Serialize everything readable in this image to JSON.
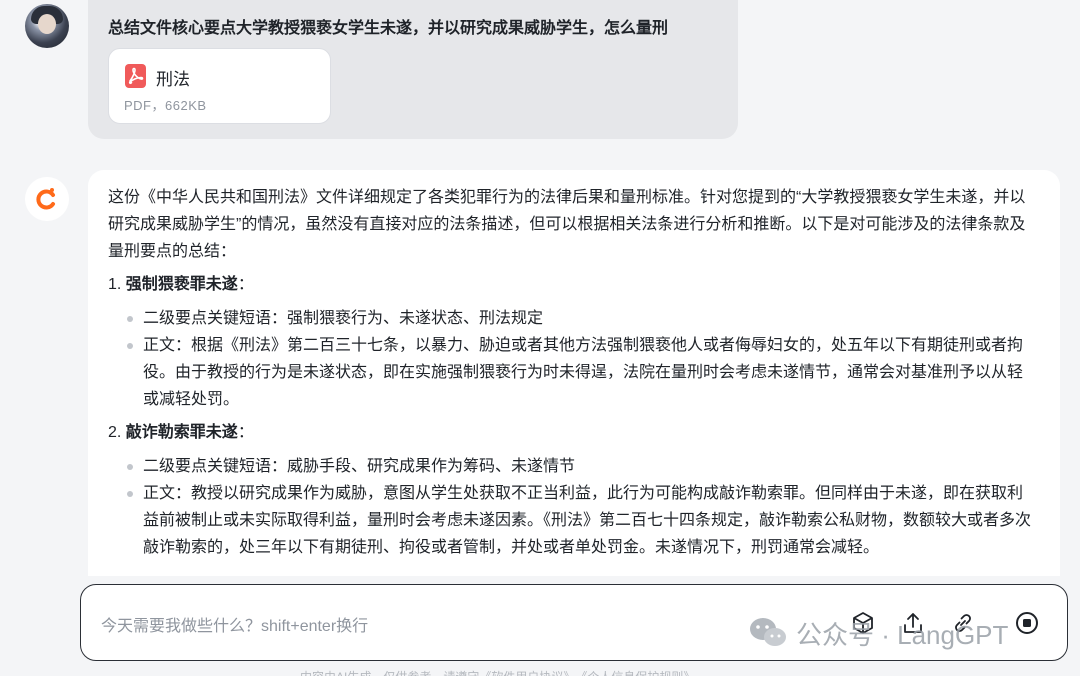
{
  "user_message": {
    "question": "总结文件核心要点大学教授猥亵女学生未遂，并以研究成果威胁学生，怎么量刑",
    "attachment": {
      "name": "刑法",
      "meta": "PDF，662KB",
      "icon": "pdf-icon"
    }
  },
  "ai_message": {
    "intro": "这份《中华人民共和国刑法》文件详细规定了各类犯罪行为的法律后果和量刑标准。针对您提到的“大学教授猥亵女学生未遂，并以研究成果威胁学生”的情况，虽然没有直接对应的法条描述，但可以根据相关法条进行分析和推断。以下是对可能涉及的法律条款及量刑要点的总结：",
    "sections": [
      {
        "number": "1.",
        "title": "强制猥亵罪未遂",
        "colon": "：",
        "bullets": [
          "二级要点关键短语：强制猥亵行为、未遂状态、刑法规定",
          "正文：根据《刑法》第二百三十七条，以暴力、胁迫或者其他方法强制猥亵他人或者侮辱妇女的，处五年以下有期徒刑或者拘役。由于教授的行为是未遂状态，即在实施强制猥亵行为时未得逞，法院在量刑时会考虑未遂情节，通常会对基准刑予以从轻或减轻处罚。"
        ]
      },
      {
        "number": "2.",
        "title": "敲诈勒索罪未遂",
        "colon": "：",
        "bullets": [
          "二级要点关键短语：威胁手段、研究成果作为筹码、未遂情节",
          "正文：教授以研究成果作为威胁，意图从学生处获取不正当利益，此行为可能构成敲诈勒索罪。但同样由于未遂，即在获取利益前被制止或未实际取得利益，量刑时会考虑未遂因素。《刑法》第二百七十四条规定，敲诈勒索公私财物，数额较大或者多次敲诈勒索的，处三年以下有期徒刑、拘役或者管制，并处或者单处罚金。未遂情况下，刑罚通常会减轻。"
        ]
      }
    ]
  },
  "input": {
    "placeholder": "今天需要我做些什么？shift+enter换行"
  },
  "toolbar": {
    "icons": [
      "cube-icon",
      "upload-icon",
      "link-icon",
      "stop-icon"
    ]
  },
  "watermark": {
    "text": "公众号 · LangGPT"
  },
  "footer": {
    "note": "内容由AI生成，仅供参考，请遵守《软件用户协议》、《个人信息保护规则》"
  },
  "colors": {
    "background": "#f4f5f7",
    "user_bubble": "#e6e7ea",
    "pdf_red": "#f05a5a",
    "brand_orange": "#ff6a1a"
  }
}
